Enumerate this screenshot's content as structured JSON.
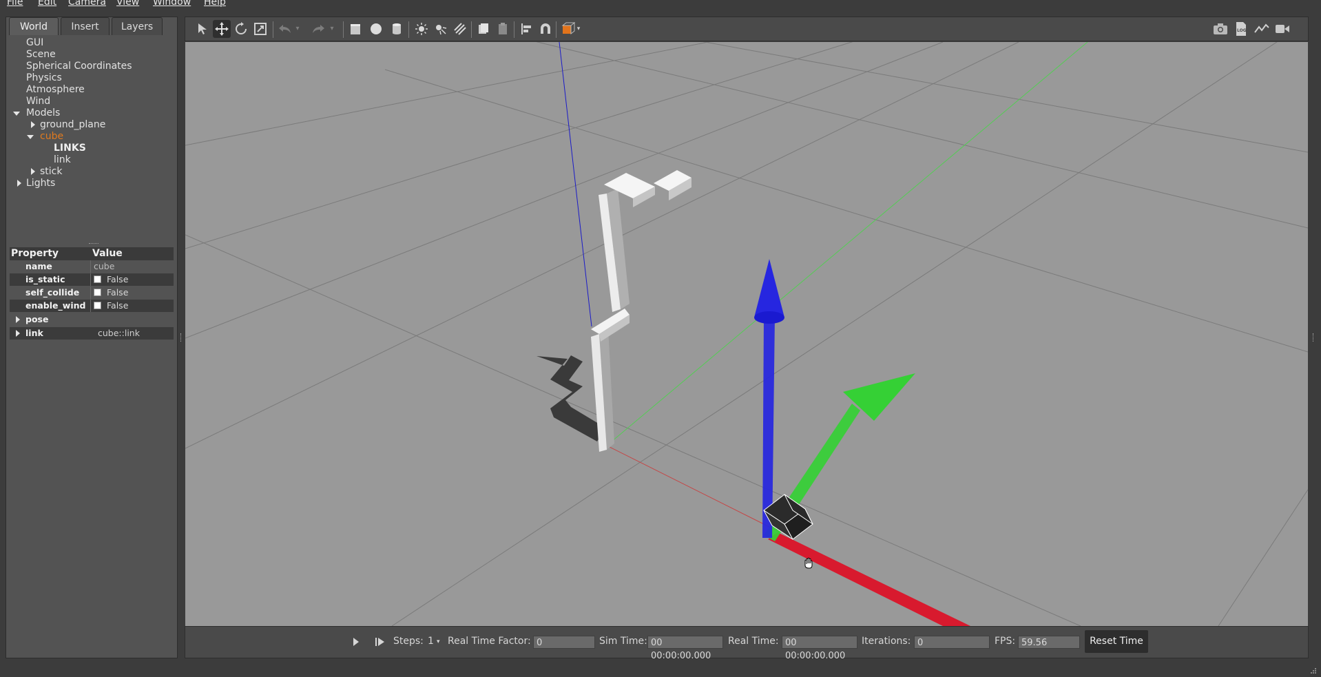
{
  "menu": [
    "File",
    "Edit",
    "Camera",
    "View",
    "Window",
    "Help"
  ],
  "tabs": [
    "World",
    "Insert",
    "Layers"
  ],
  "tree": {
    "gui": "GUI",
    "scene": "Scene",
    "spherical": "Spherical Coordinates",
    "physics": "Physics",
    "atmosphere": "Atmosphere",
    "wind": "Wind",
    "models": "Models",
    "ground_plane": "ground_plane",
    "cube": "cube",
    "links_header": "LINKS",
    "link": "link",
    "stick": "stick",
    "lights": "Lights"
  },
  "properties": {
    "header_property": "Property",
    "header_value": "Value",
    "name_label": "name",
    "name_value": "cube",
    "is_static_label": "is_static",
    "is_static_value": "False",
    "self_collide_label": "self_collide",
    "self_collide_value": "False",
    "enable_wind_label": "enable_wind",
    "enable_wind_value": "False",
    "pose_label": "pose",
    "link_label": "link",
    "link_value": "cube::link"
  },
  "toolbar_icons": {
    "log_label": "LOG"
  },
  "bottom": {
    "steps_label": "Steps:",
    "steps_value": "1",
    "rtf_label": "Real Time Factor:",
    "rtf_value": "0",
    "sim_time_label": "Sim Time:",
    "sim_time_value": "00 00:00:00.000",
    "real_time_label": "Real Time:",
    "real_time_value": "00 00:00:00.000",
    "iterations_label": "Iterations:",
    "iterations_value": "0",
    "fps_label": "FPS:",
    "fps_value": "59.56",
    "reset_label": "Reset Time"
  },
  "colors": {
    "selected_item": "#e07a1f",
    "axis_x": "#d81a2e",
    "axis_y": "#35d035",
    "axis_z": "#2626e0",
    "viewport_bg": "#999999"
  }
}
